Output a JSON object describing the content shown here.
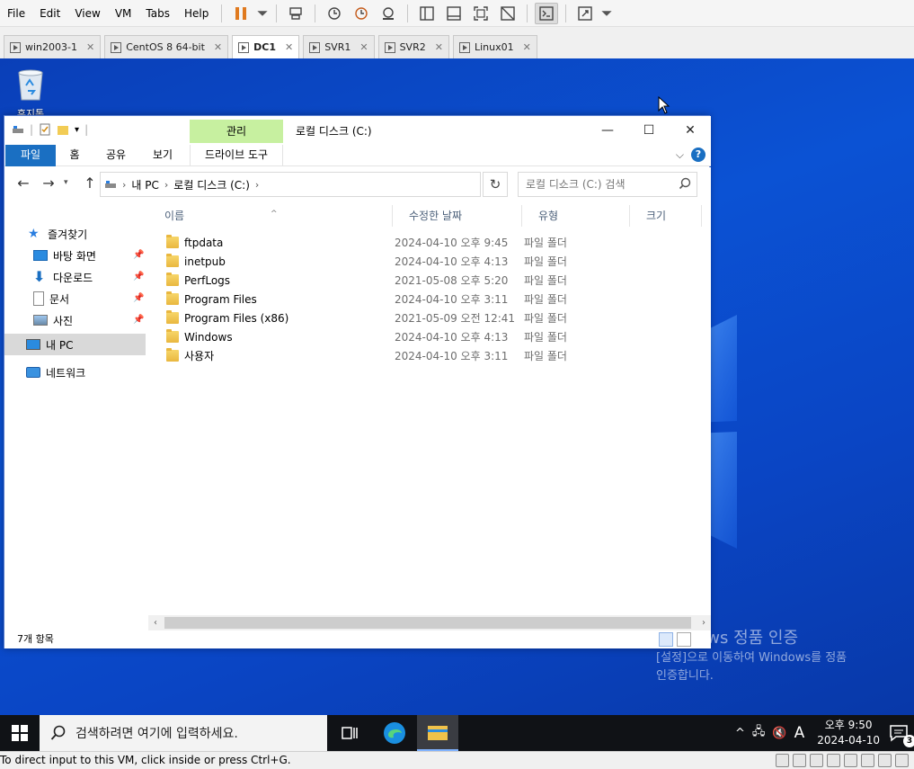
{
  "vm": {
    "menu": [
      "File",
      "Edit",
      "View",
      "VM",
      "Tabs",
      "Help"
    ],
    "tabs": [
      {
        "label": "win2003-1",
        "active": false
      },
      {
        "label": "CentOS 8 64-bit",
        "active": false
      },
      {
        "label": "DC1",
        "active": true
      },
      {
        "label": "SVR1",
        "active": false
      },
      {
        "label": "SVR2",
        "active": false
      },
      {
        "label": "Linux01",
        "active": false
      }
    ],
    "status_text": "To direct input to this VM, click inside or press Ctrl+G."
  },
  "desktop": {
    "recycle_bin_label": "휴지통",
    "watermark_title": "Windows 정품 인증",
    "watermark_line1": "[설정]으로 이동하여 Windows를 정품",
    "watermark_line2": "인증합니다."
  },
  "explorer": {
    "context_tab_group": "관리",
    "title": "로컬 디스크 (C:)",
    "ribbon_tabs": {
      "file": "파일",
      "home": "홈",
      "share": "공유",
      "view": "보기",
      "drive_tools": "드라이브 도구"
    },
    "address": {
      "segments": [
        "내 PC",
        "로컬 디스크 (C:)"
      ]
    },
    "search_placeholder": "로컬 디스크 (C:) 검색",
    "sidebar": {
      "quick_access": "즐겨찾기",
      "items": [
        {
          "label": "바탕 화면",
          "icon": "desktop-icon",
          "pinned": true
        },
        {
          "label": "다운로드",
          "icon": "download-icon",
          "pinned": true
        },
        {
          "label": "문서",
          "icon": "document-icon",
          "pinned": true
        },
        {
          "label": "사진",
          "icon": "picture-icon",
          "pinned": true
        }
      ],
      "this_pc": "내 PC",
      "network": "네트워크"
    },
    "columns": {
      "name": "이름",
      "date": "수정한 날짜",
      "type": "유형",
      "size": "크기"
    },
    "files": [
      {
        "name": "ftpdata",
        "date": "2024-04-10 오후 9:45",
        "type": "파일 폴더"
      },
      {
        "name": "inetpub",
        "date": "2024-04-10 오후 4:13",
        "type": "파일 폴더"
      },
      {
        "name": "PerfLogs",
        "date": "2021-05-08 오후 5:20",
        "type": "파일 폴더"
      },
      {
        "name": "Program Files",
        "date": "2024-04-10 오후 3:11",
        "type": "파일 폴더"
      },
      {
        "name": "Program Files (x86)",
        "date": "2021-05-09 오전 12:41",
        "type": "파일 폴더"
      },
      {
        "name": "Windows",
        "date": "2024-04-10 오후 4:13",
        "type": "파일 폴더"
      },
      {
        "name": "사용자",
        "date": "2024-04-10 오후 3:11",
        "type": "파일 폴더"
      }
    ],
    "status": "7개 항목"
  },
  "taskbar": {
    "search_placeholder": "검색하려면 여기에 입력하세요.",
    "ime": "A",
    "time": "오후 9:50",
    "date": "2024-04-10",
    "notification_count": "3"
  }
}
